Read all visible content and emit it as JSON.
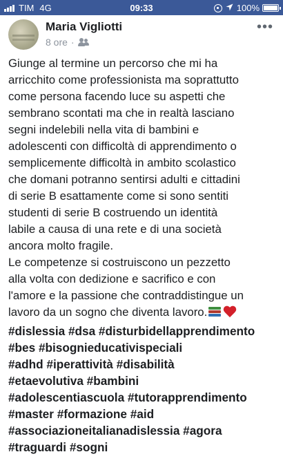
{
  "status_bar": {
    "carrier": "TIM",
    "network": "4G",
    "time": "09:33",
    "battery": "100%"
  },
  "post": {
    "author": "Maria Vigliotti",
    "time": "8 ore",
    "separator": "·",
    "privacy_icon": "friends-icon",
    "more_label": "•••",
    "paragraph1": "Giunge al termine un percorso che mi ha\narricchito come professionista ma soprattutto\ncome persona facendo luce su aspetti che\nsembrano scontati ma che in realtà lasciano\nsegni indelebili nella vita di bambini e\nadolescenti con difficoltà di apprendimento o\nsemplicemente difficoltà in ambito scolastico\nche domani potranno sentirsi adulti e cittadini\ndi serie B esattamente come si sono sentiti\nstudenti di serie B costruendo un identità\nlabile a causa di una rete e di una società\nancora molto fragile.",
    "paragraph2": "Le competenze si costruiscono un pezzetto\nalla volta con dedizione e sacrifico e con\nl'amore e la passione che contraddistingue un\nlavoro da un sogno che diventa lavoro.",
    "emoji_icons": [
      "books-icon",
      "heart-icon"
    ],
    "hashtag_lines": [
      "#dislessia #dsa #disturbidellapprendimento",
      "#bes #bisognieducativispeciali",
      "#adhd #iperattività #disabilità",
      "#etaevolutiva #bambini",
      "#adolescentiascuola #tutorapprendimento",
      "#master #formazione #aid",
      "#associazioneitalianadislessia #agora",
      "#traguardi #sogni"
    ]
  },
  "colors": {
    "status_bar": "#3b5998",
    "text": "#1c1e21",
    "meta": "#8d949e",
    "heart": "#d3202a"
  }
}
